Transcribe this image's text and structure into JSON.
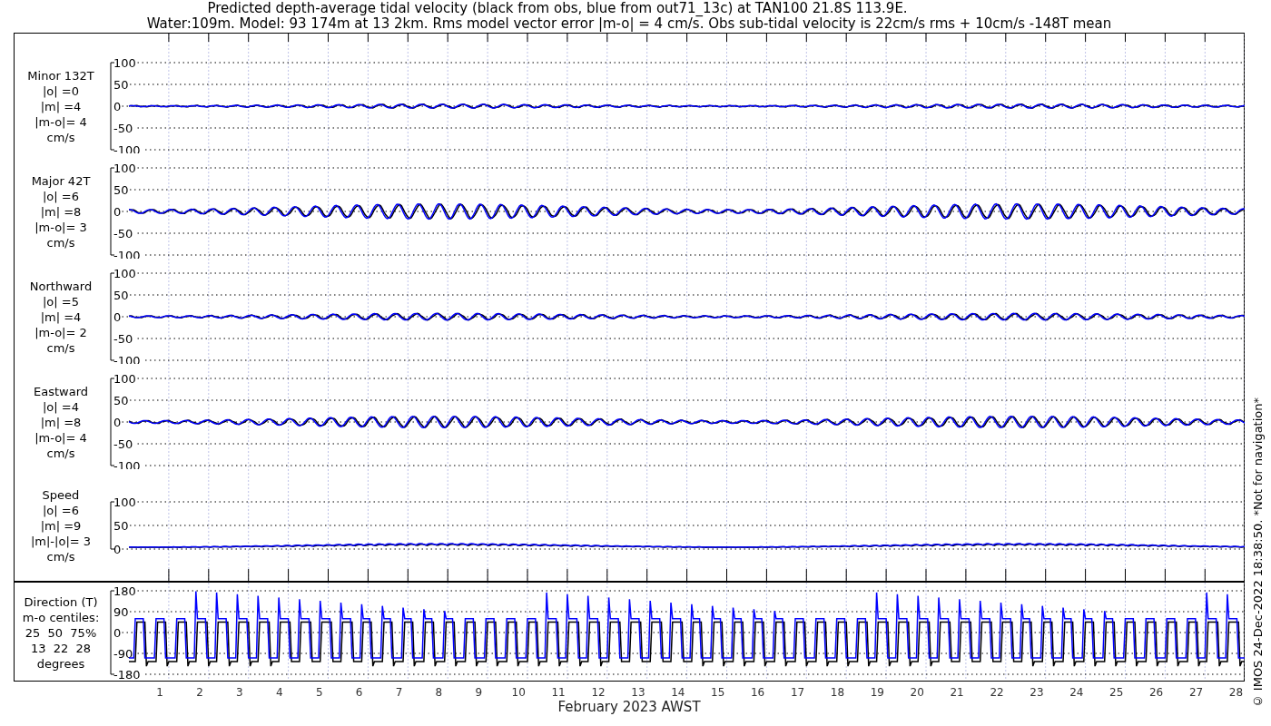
{
  "title_lines": [
    "Predicted depth-average tidal velocity (black from obs, blue from out71_13c) at TAN100 21.8S 113.9E.",
    "Water:109m. Model: 93 174m at 13 2km. Rms model vector error |m-o| = 4 cm/s. Obs sub-tidal velocity is 22cm/s rms + 10cm/s -148T mean"
  ],
  "panels": [
    {
      "kind": "velocity",
      "label_lines": [
        "Minor 132T",
        "|o| =0",
        "|m| =4",
        "|m-o|= 4",
        "cm/s"
      ],
      "yticks": [
        "100",
        "50",
        "0",
        "-50",
        "-100"
      ]
    },
    {
      "kind": "velocity",
      "label_lines": [
        "Major 42T",
        "|o| =6",
        "|m| =8",
        "|m-o|= 3",
        "cm/s"
      ],
      "yticks": [
        "100",
        "50",
        "0",
        "-50",
        "-100"
      ]
    },
    {
      "kind": "velocity",
      "label_lines": [
        "Northward",
        "|o| =5",
        "|m| =4",
        "|m-o|= 2",
        "cm/s"
      ],
      "yticks": [
        "100",
        "50",
        "0",
        "-50",
        "-100"
      ]
    },
    {
      "kind": "velocity",
      "label_lines": [
        "Eastward",
        "|o| =4",
        "|m| =8",
        "|m-o|= 4",
        "cm/s"
      ],
      "yticks": [
        "100",
        "50",
        "0",
        "-50",
        "-100"
      ]
    },
    {
      "kind": "speed",
      "label_lines": [
        "Speed",
        "|o| =6",
        "|m| =9",
        "|m|-|o|= 3",
        "cm/s"
      ],
      "yticks": [
        "100",
        "50",
        "0"
      ]
    },
    {
      "kind": "direction",
      "label_lines": [
        "Direction (T)",
        "m-o centiles:",
        "25  50  75%",
        "13  22  28",
        "degrees"
      ],
      "yticks": [
        "180",
        "90",
        "0",
        "-90",
        "-180"
      ]
    }
  ],
  "x_ticks": [
    "1",
    "2",
    "3",
    "4",
    "5",
    "6",
    "7",
    "8",
    "9",
    "10",
    "11",
    "12",
    "13",
    "14",
    "15",
    "16",
    "17",
    "18",
    "19",
    "20",
    "21",
    "22",
    "23",
    "24",
    "25",
    "26",
    "27",
    "28"
  ],
  "xlabel": "February 2023 AWST",
  "side_note": "© IMOS 24-Dec-2022 18:38:50. *Not for navigation*"
}
